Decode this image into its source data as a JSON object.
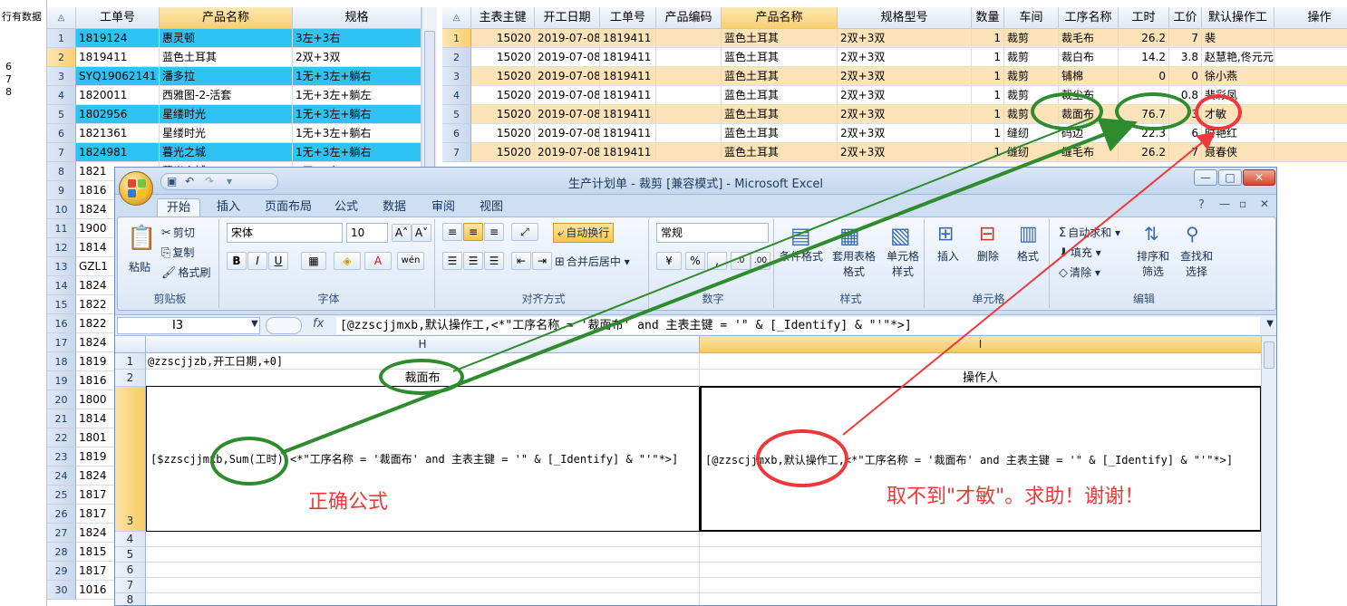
{
  "left_strip": {
    "label": "行有数据",
    "digits": [
      "6",
      "7",
      "8"
    ]
  },
  "grid1": {
    "headers": [
      "工单号",
      "产品名称",
      "规格"
    ],
    "rows": [
      [
        "1819124",
        "惠灵顿",
        "3左+3右"
      ],
      [
        "1819411",
        "蓝色土耳其",
        "2双+3双"
      ],
      [
        "SYQ19062141",
        "潘多拉",
        "1无+3左+躺右"
      ],
      [
        "1820011",
        "西雅图-2-活套",
        "1无+3左+躺左"
      ],
      [
        "1802956",
        "星缕时光",
        "1无+3左+躺右"
      ],
      [
        "1821361",
        "星缕时光",
        "1无+3左+躺右"
      ],
      [
        "1824981",
        "暮光之城",
        "1无+3左+躺右"
      ],
      [
        "1821",
        "暮光之城",
        "1无+3左"
      ],
      [
        "1816",
        "",
        ""
      ],
      [
        "1824",
        "",
        ""
      ],
      [
        "1900",
        "",
        ""
      ],
      [
        "1814",
        "",
        ""
      ],
      [
        "GZL1",
        "",
        ""
      ],
      [
        "1824",
        "",
        ""
      ],
      [
        "1822",
        "",
        ""
      ],
      [
        "1822",
        "",
        ""
      ],
      [
        "1824",
        "",
        ""
      ],
      [
        "1819",
        "",
        ""
      ],
      [
        "1816",
        "",
        ""
      ],
      [
        "1800",
        "",
        ""
      ],
      [
        "1814",
        "",
        ""
      ],
      [
        "1801",
        "",
        ""
      ],
      [
        "1819",
        "",
        ""
      ],
      [
        "1824",
        "",
        ""
      ],
      [
        "1817",
        "",
        ""
      ],
      [
        "1817",
        "",
        ""
      ],
      [
        "1824",
        "",
        ""
      ],
      [
        "1815",
        "",
        ""
      ],
      [
        "1817",
        "",
        ""
      ],
      [
        "1016",
        "",
        ""
      ]
    ]
  },
  "grid2": {
    "headers": [
      "主表主键",
      "开工日期",
      "工单号",
      "产品编码",
      "产品名称",
      "规格型号",
      "数量",
      "车间",
      "工序名称",
      "工时",
      "工价",
      "默认操作工",
      "操作"
    ],
    "rows": [
      [
        "15020",
        "2019-07-08",
        "1819411",
        "",
        "蓝色土耳其",
        "2双+3双",
        "1",
        "裁剪",
        "裁毛布",
        "26.2",
        "7",
        "裴"
      ],
      [
        "15020",
        "2019-07-08",
        "1819411",
        "",
        "蓝色土耳其",
        "2双+3双",
        "1",
        "裁剪",
        "裁白布",
        "14.2",
        "3.8",
        "赵慧艳,佟元元"
      ],
      [
        "15020",
        "2019-07-08",
        "1819411",
        "",
        "蓝色土耳其",
        "2双+3双",
        "1",
        "裁剪",
        "铺棉",
        "0",
        "0",
        "徐小燕"
      ],
      [
        "15020",
        "2019-07-08",
        "1819411",
        "",
        "蓝色土耳其",
        "2双+3双",
        "1",
        "裁剪",
        "裁尘布",
        "",
        "0.8",
        "裴彩凤"
      ],
      [
        "15020",
        "2019-07-08",
        "1819411",
        "",
        "蓝色土耳其",
        "2双+3双",
        "1",
        "裁剪",
        "裁面布",
        "76.7",
        "3",
        "才敏"
      ],
      [
        "15020",
        "2019-07-08",
        "1819411",
        "",
        "蓝色土耳其",
        "2双+3双",
        "1",
        "缝纫",
        "码边",
        "22.3",
        "6",
        "时艳红"
      ],
      [
        "15020",
        "2019-07-08",
        "1819411",
        "",
        "蓝色土耳其",
        "2双+3双",
        "1",
        "缝纫",
        "缝毛布",
        "26.2",
        "7",
        "聂春侠"
      ]
    ]
  },
  "excel": {
    "title": "生产计划单 - 裁剪  [兼容模式] - Microsoft Excel",
    "tabs": [
      "开始",
      "插入",
      "页面布局",
      "公式",
      "数据",
      "审阅",
      "视图"
    ],
    "clipboard": {
      "paste": "粘贴",
      "cut": "剪切",
      "copy": "复制",
      "format_painter": "格式刷",
      "label": "剪贴板"
    },
    "font": {
      "name": "宋体",
      "size": "10",
      "label": "字体"
    },
    "alignment": {
      "wrap": "自动换行",
      "merge": "合并后居中",
      "label": "对齐方式"
    },
    "number": {
      "format": "常规",
      "label": "数字"
    },
    "styles": {
      "conditional": "条件格式",
      "table": "套用表格格式",
      "cell": "单元格样式",
      "label": "样式"
    },
    "cells": {
      "insert": "插入",
      "delete": "删除",
      "format": "格式",
      "label": "单元格"
    },
    "editing": {
      "autosum": "自动求和",
      "fill": "填充",
      "clear": "清除",
      "sort": "排序和筛选",
      "find": "查找和选择",
      "label": "编辑"
    },
    "name_box": "I3",
    "formula": "[@zzscjjmxb,默认操作工,<*\"工序名称 = '裁面布' and 主表主键 = '\" & [_Identify] & \"'\"*>]",
    "columns": [
      "H",
      "I"
    ],
    "row_numbers": [
      "1",
      "2",
      "3",
      "4",
      "5",
      "6",
      "7",
      "8"
    ],
    "h1": "@zzscjjzb,开工日期,+0]",
    "h2": "裁面布",
    "i2": "操作人",
    "h3": "[$zzscjjmxb,Sum(工时),<*\"工序名称 = '裁面布' and 主表主键 = '\" & [_Identify] & \"'\"*>]",
    "i3": "[@zzscjjmxb,默认操作工,<*\"工序名称 = '裁面布' and 主表主键 = '\" & [_Identify] & \"'\"*>]"
  },
  "annotations": {
    "correct": "正确公式",
    "help": "取不到\"才敏\"。求助！谢谢！"
  },
  "colors": {
    "green": "#2e8b2e",
    "red": "#f0383a",
    "cyan": "#2fc3f3",
    "peach": "#fde3b8"
  }
}
